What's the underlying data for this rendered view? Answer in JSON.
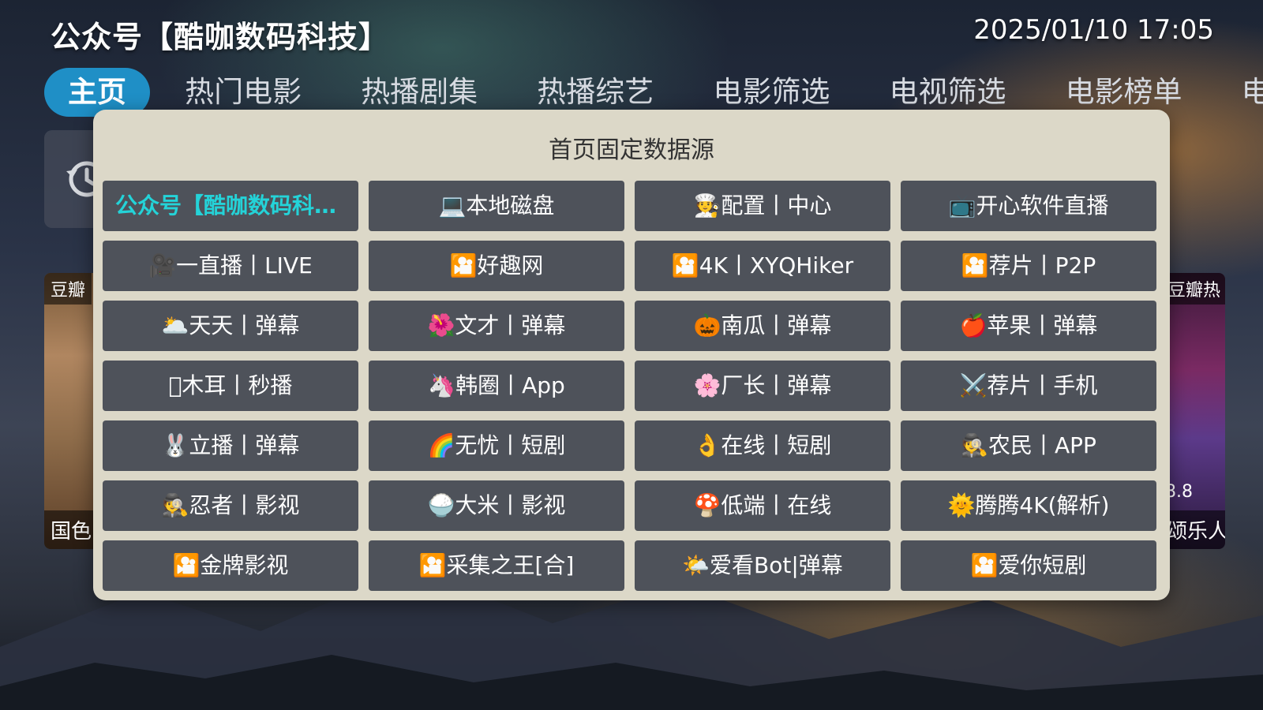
{
  "header": {
    "title": "公众号【酷咖数码科技】",
    "datetime": "2025/01/10 17:05"
  },
  "tabs": [
    {
      "label": "主页",
      "active": true
    },
    {
      "label": "热门电影",
      "active": false
    },
    {
      "label": "热播剧集",
      "active": false
    },
    {
      "label": "热播综艺",
      "active": false
    },
    {
      "label": "电影筛选",
      "active": false
    },
    {
      "label": "电视筛选",
      "active": false
    },
    {
      "label": "电影榜单",
      "active": false
    },
    {
      "label": "电",
      "active": false
    }
  ],
  "background_cards": {
    "left": {
      "badge": "豆瓣",
      "caption": "国色"
    },
    "right": {
      "badge": "豆瓣热",
      "rating": "8.8",
      "caption": "颂乐人"
    },
    "edge_tab": "电"
  },
  "dialog": {
    "title": "首页固定数据源",
    "sources": [
      {
        "label": "公众号【酷咖数码科技】",
        "selected": true
      },
      {
        "label": "💻本地磁盘"
      },
      {
        "label": "🧑‍🍳配置丨中心"
      },
      {
        "label": "📺开心软件直播"
      },
      {
        "label": "🎥一直播丨LIVE"
      },
      {
        "label": "🎦好趣网"
      },
      {
        "label": "🎦4K丨XYQHiker"
      },
      {
        "label": "🎦荐片丨P2P"
      },
      {
        "label": "🌥️天天丨弹幕"
      },
      {
        "label": "🌺文才丨弹幕"
      },
      {
        "label": "🎃南瓜丨弹幕"
      },
      {
        "label": "🍎苹果丨弹幕"
      },
      {
        "label": "􏿽木耳丨秒播"
      },
      {
        "label": "🦄韩圈丨App"
      },
      {
        "label": "🌸厂长丨弹幕"
      },
      {
        "label": "⚔️荐片丨手机"
      },
      {
        "label": "🐰立播丨弹幕"
      },
      {
        "label": "🌈无忧丨短剧"
      },
      {
        "label": "👌在线丨短剧"
      },
      {
        "label": "🕵️农民丨APP"
      },
      {
        "label": "🕵️忍者丨影视"
      },
      {
        "label": "🍚大米丨影视"
      },
      {
        "label": "🍄低端丨在线"
      },
      {
        "label": "🌞腾腾4K(解析)"
      },
      {
        "label": "🎦金牌影视"
      },
      {
        "label": "🎦采集之王[合]"
      },
      {
        "label": "🌤️爱看Bot|弹幕"
      },
      {
        "label": "🎦爱你短剧"
      }
    ]
  },
  "colors": {
    "active_tab": "#1f8fc6",
    "selected_text": "#24d3d8",
    "dialog_bg": "#dcd8c8",
    "button_bg": "#4e525a"
  }
}
